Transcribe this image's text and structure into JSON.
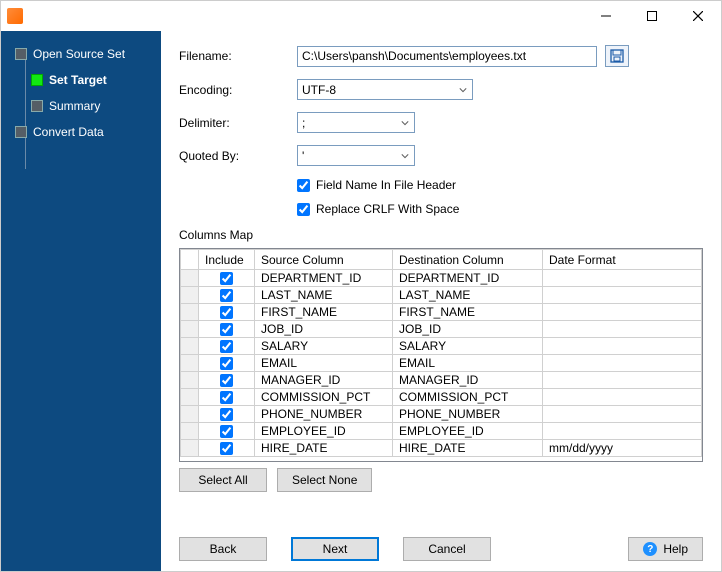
{
  "sidebar": {
    "items": [
      {
        "label": "Open Source Set",
        "active": false
      },
      {
        "label": "Set Target",
        "active": true
      },
      {
        "label": "Summary",
        "active": false
      },
      {
        "label": "Convert Data",
        "active": false
      }
    ]
  },
  "form": {
    "filename_label": "Filename:",
    "filename_value": "C:\\Users\\pansh\\Documents\\employees.txt",
    "encoding_label": "Encoding:",
    "encoding_value": "UTF-8",
    "delimiter_label": "Delimiter:",
    "delimiter_value": ";",
    "quotedby_label": "Quoted By:",
    "quotedby_value": "'",
    "fieldname_checkbox": "Field Name In File Header",
    "fieldname_checked": true,
    "replacecrlf_checkbox": "Replace CRLF With Space",
    "replacecrlf_checked": true
  },
  "columns_map": {
    "title": "Columns Map",
    "headers": {
      "include": "Include",
      "source": "Source Column",
      "destination": "Destination Column",
      "date": "Date Format"
    },
    "rows": [
      {
        "include": true,
        "source": "DEPARTMENT_ID",
        "destination": "DEPARTMENT_ID",
        "date": ""
      },
      {
        "include": true,
        "source": "LAST_NAME",
        "destination": "LAST_NAME",
        "date": ""
      },
      {
        "include": true,
        "source": "FIRST_NAME",
        "destination": "FIRST_NAME",
        "date": ""
      },
      {
        "include": true,
        "source": "JOB_ID",
        "destination": "JOB_ID",
        "date": ""
      },
      {
        "include": true,
        "source": "SALARY",
        "destination": "SALARY",
        "date": ""
      },
      {
        "include": true,
        "source": "EMAIL",
        "destination": "EMAIL",
        "date": ""
      },
      {
        "include": true,
        "source": "MANAGER_ID",
        "destination": "MANAGER_ID",
        "date": ""
      },
      {
        "include": true,
        "source": "COMMISSION_PCT",
        "destination": "COMMISSION_PCT",
        "date": ""
      },
      {
        "include": true,
        "source": "PHONE_NUMBER",
        "destination": "PHONE_NUMBER",
        "date": ""
      },
      {
        "include": true,
        "source": "EMPLOYEE_ID",
        "destination": "EMPLOYEE_ID",
        "date": ""
      },
      {
        "include": true,
        "source": "HIRE_DATE",
        "destination": "HIRE_DATE",
        "date": "mm/dd/yyyy"
      }
    ]
  },
  "buttons": {
    "select_all": "Select All",
    "select_none": "Select None",
    "back": "Back",
    "next": "Next",
    "cancel": "Cancel",
    "help": "Help"
  }
}
